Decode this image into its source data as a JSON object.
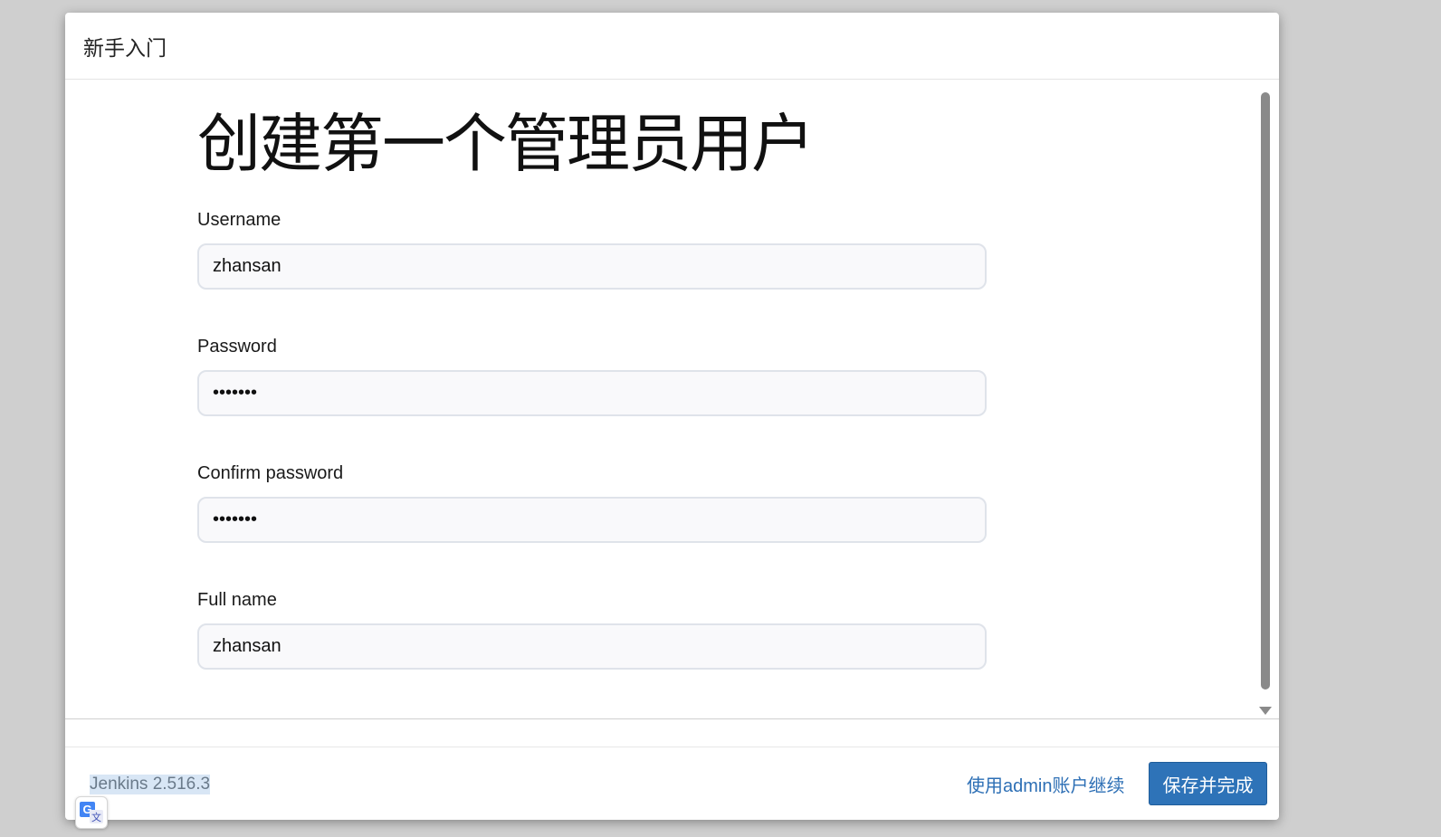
{
  "dialog": {
    "header_title": "新手入门",
    "page_title": "创建第一个管理员用户"
  },
  "form": {
    "fields": [
      {
        "label": "Username",
        "value": "zhansan",
        "type": "text"
      },
      {
        "label": "Password",
        "value": "•••••••",
        "type": "password"
      },
      {
        "label": "Confirm password",
        "value": "•••••••",
        "type": "password"
      },
      {
        "label": "Full name",
        "value": "zhansan",
        "type": "text"
      }
    ]
  },
  "footer": {
    "version": "Jenkins 2.516.3",
    "skip_link": "使用admin账户继续",
    "save_button": "保存并完成"
  },
  "icons": {
    "translate": "google-translate-icon",
    "scroll_down": "chevron-down-icon"
  },
  "colors": {
    "primary_button": "#2e73b8",
    "link": "#2d6fb5"
  }
}
